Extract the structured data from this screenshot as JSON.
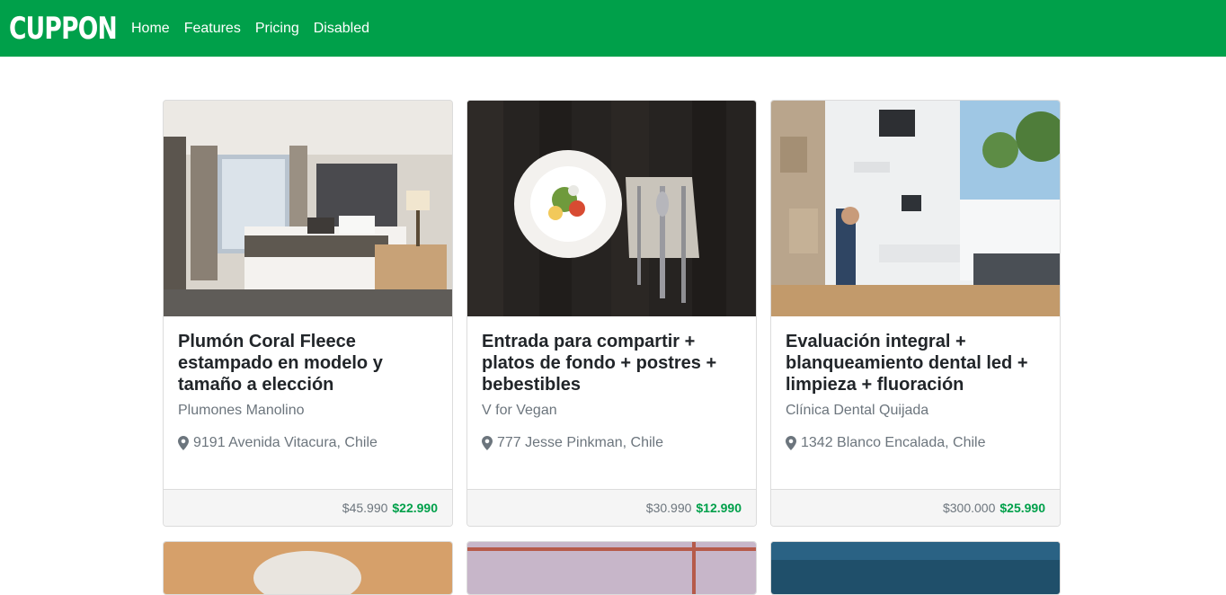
{
  "navbar": {
    "brand": "CUPPON",
    "links": [
      {
        "label": "Home"
      },
      {
        "label": "Features"
      },
      {
        "label": "Pricing"
      },
      {
        "label": "Disabled"
      }
    ]
  },
  "colors": {
    "accent": "#00a04a",
    "muted": "#6c757d",
    "footer_bg": "#f5f5f5"
  },
  "deals": [
    {
      "title": "Plumón Coral Fleece estampado en modelo y tamaño a elección",
      "vendor": "Plumones Manolino",
      "location": "9191 Avenida Vitacura, Chile",
      "old_price": "$45.990",
      "new_price": "$22.990",
      "image": "hotel-bedroom"
    },
    {
      "title": "Entrada para compartir + platos de fondo + postres + bebestibles",
      "vendor": "V for Vegan",
      "location": "777 Jesse Pinkman, Chile",
      "old_price": "$30.990",
      "new_price": "$12.990",
      "image": "plate-and-cutlery"
    },
    {
      "title": "Evaluación integral + blanqueamiento dental led + limpieza + fluoración",
      "vendor": "Clínica Dental Quijada",
      "location": "1342 Blanco Encalada, Chile",
      "old_price": "$300.000",
      "new_price": "$25.990",
      "image": "dental-clinic"
    }
  ]
}
